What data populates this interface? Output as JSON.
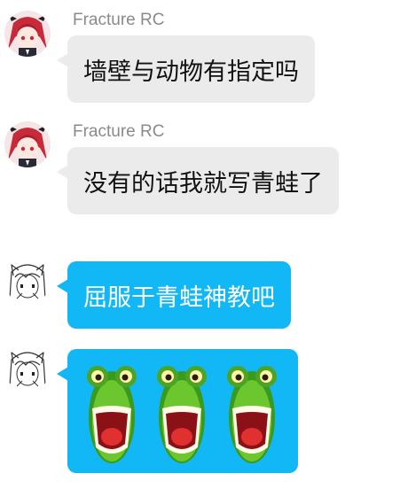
{
  "messages": [
    {
      "sender": "Fracture RC",
      "text": "墙壁与动物有指定吗",
      "side": "incoming",
      "avatar": "anime-girl-red-hair-avatar"
    },
    {
      "sender": "Fracture RC",
      "text": "没有的话我就写青蛙了",
      "side": "incoming",
      "avatar": "anime-girl-red-hair-avatar"
    },
    {
      "text": "屈服于青蛙神教吧",
      "side": "self",
      "avatar": "sketch-girl-avatar"
    },
    {
      "emojis": [
        "frog-emoji",
        "frog-emoji",
        "frog-emoji"
      ],
      "side": "self",
      "avatar": "sketch-girl-avatar"
    }
  ],
  "colors": {
    "incoming_bubble": "#ebebeb",
    "self_bubble": "#12b7f5",
    "sender_name": "#8a8a8a"
  }
}
